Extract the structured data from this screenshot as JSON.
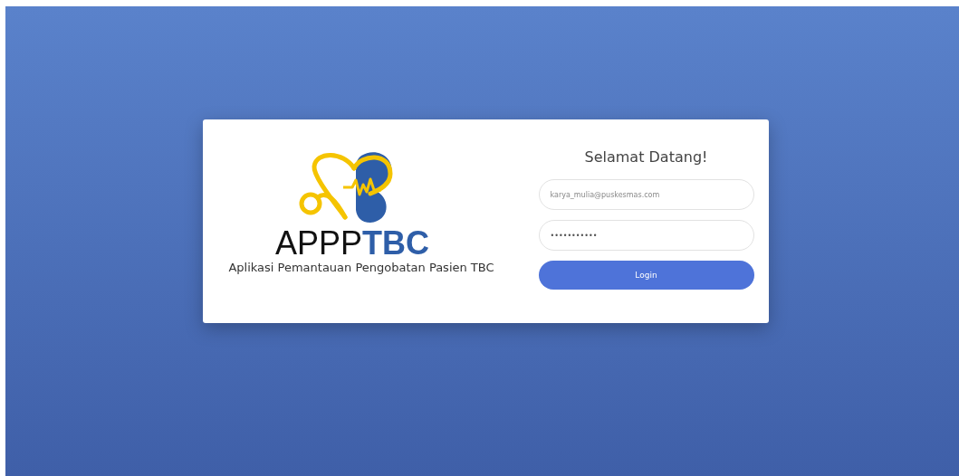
{
  "brand": {
    "name": "APPP**TBC**",
    "tagline": "Aplikasi Pemantauan Pengobatan Pasien TBC"
  },
  "login": {
    "title": "Selamat Datang!",
    "email": {
      "placeholder": "karya_mulia@puskesmas.com"
    },
    "password": {
      "value": "•••••••••••"
    },
    "button": "Login"
  }
}
